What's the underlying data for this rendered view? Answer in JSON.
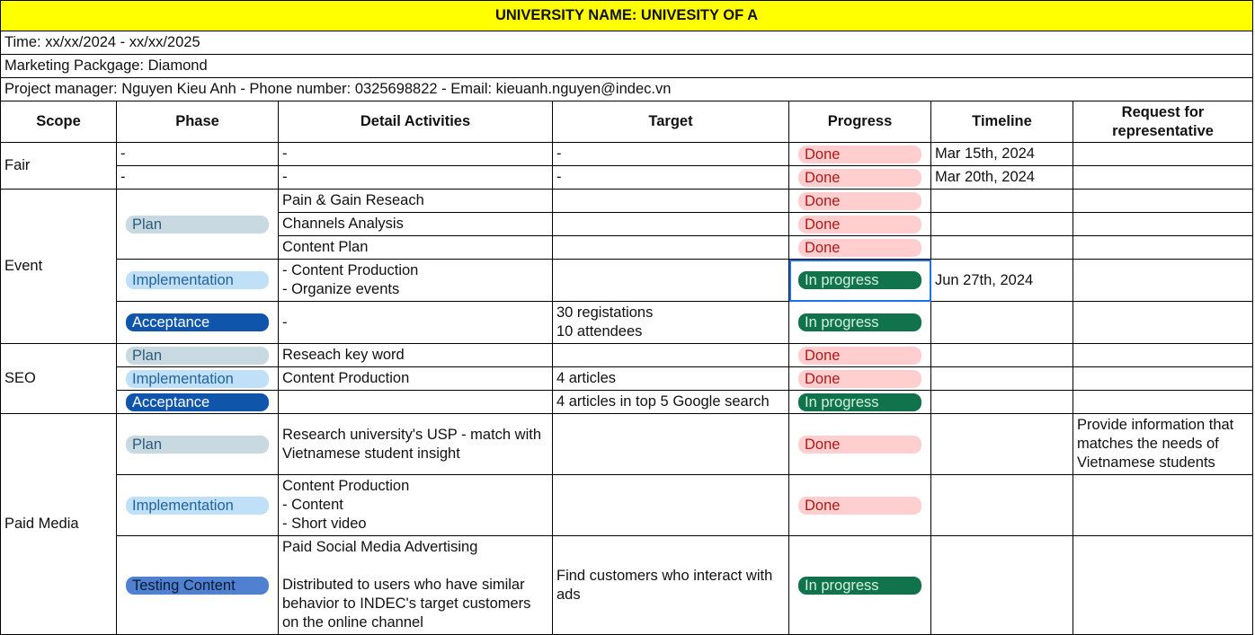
{
  "sheet": {
    "title": "UNIVERSITY NAME: UNIVESITY OF A",
    "time": "Time: xx/xx/2024 - xx/xx/2025",
    "package": "Marketing Packgage: Diamond",
    "manager": "Project manager: Nguyen Kieu Anh - Phone number: 0325698822 - Email: kieuanh.nguyen@indec.vn"
  },
  "headers": [
    "Scope",
    "Phase",
    "Detail Activities",
    "Target",
    "Progress",
    "Timeline",
    "Request for representative"
  ],
  "scopes": [
    "Fair",
    "Event",
    "SEO",
    "Paid Media"
  ],
  "phases": {
    "plan": "Plan",
    "implementation": "Implementation",
    "acceptance": "Acceptance",
    "testing": "Testing Content"
  },
  "status": {
    "done": "Done",
    "in_progress": "In progress"
  },
  "dash": "-",
  "fair": {
    "timeline_1": "Mar 15th, 2024",
    "timeline_2": "Mar 20th, 2024"
  },
  "event": {
    "activity_1": "Pain & Gain Reseach",
    "activity_2": "Channels Analysis",
    "activity_3": "Content Plan",
    "activity_4_line1": "- Content Production",
    "activity_4_line2": "- Organize events",
    "timeline_4": "Jun 27th, 2024",
    "target_5_line1": "30 registations",
    "target_5_line2": "10 attendees"
  },
  "seo": {
    "activity_1": "Reseach key word",
    "activity_2": "Content Production",
    "target_2": "4 articles",
    "target_3": "4 articles in top 5 Google search"
  },
  "paid_media": {
    "activity_1": "Research university's USP - match with Vietnamese student insight",
    "request_1": "Provide information that matches the needs of Vietnamese students",
    "activity_2_line1": "Content Production",
    "activity_2_line2": "- Content",
    "activity_2_line3": "- Short video",
    "activity_3_line1": "Paid Social Media Advertising",
    "activity_3_line2": "Distributed to users who have similar behavior to INDEC's target customers on the online channel",
    "target_3": "Find customers who interact with ads"
  }
}
